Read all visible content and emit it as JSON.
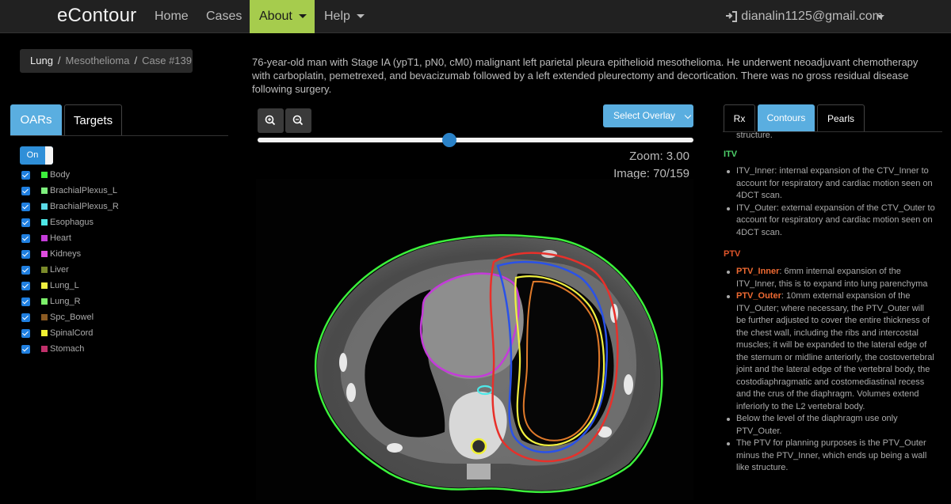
{
  "navbar": {
    "brand": "eContour",
    "home": "Home",
    "cases": "Cases",
    "about": "About",
    "help": "Help",
    "user": "dianalin1125@gmail.com",
    "accent": "#a6cc4d"
  },
  "breadcrumb": {
    "items": [
      "Lung",
      "Mesothelioma",
      "Case #139"
    ]
  },
  "case_description": "76-year-old man with Stage IA (ypT1, pN0, cM0) malignant left parietal pleura epithelioid mesothelioma. He underwent neoadjuvant chemotherapy with carboplatin, pemetrexed, and bevacizumab followed by a left extended pleurectomy and decortication. There was no gross residual disease following surgery.",
  "left_panel": {
    "tabs": [
      "OARs",
      "Targets"
    ],
    "toggle_label": "On",
    "structures": [
      {
        "name": "Body",
        "color": "#3cf03c",
        "checked": true
      },
      {
        "name": "BrachialPlexus_L",
        "color": "#7ef07e",
        "checked": true
      },
      {
        "name": "BrachialPlexus_R",
        "color": "#5ad9e6",
        "checked": true
      },
      {
        "name": "Esophagus",
        "color": "#4ee8e8",
        "checked": true
      },
      {
        "name": "Heart",
        "color": "#c43cd9",
        "checked": true
      },
      {
        "name": "Kidneys",
        "color": "#e04ce0",
        "checked": true
      },
      {
        "name": "Liver",
        "color": "#7a8a2a",
        "checked": true
      },
      {
        "name": "Lung_L",
        "color": "#f0f040",
        "checked": true
      },
      {
        "name": "Lung_R",
        "color": "#7cf06a",
        "checked": true
      },
      {
        "name": "Spc_Bowel",
        "color": "#8a5a22",
        "checked": true
      },
      {
        "name": "SpinalCord",
        "color": "#f0f032",
        "checked": true
      },
      {
        "name": "Stomach",
        "color": "#c0306a",
        "checked": true
      }
    ]
  },
  "viewer": {
    "select_overlay": "Select Overlay",
    "zoom_text": "Zoom: 3.00",
    "image_text": "Image: 70/159",
    "slider_fraction": 0.44,
    "zoom_in_icon": "zoom-in-icon",
    "zoom_out_icon": "zoom-out-icon"
  },
  "right_panel": {
    "tabs": [
      "Rx",
      "Contours",
      "Pearls"
    ],
    "top_fragment": "structure.",
    "itv_heading": "ITV",
    "itv_items": [
      "ITV_Inner: internal expansion of the CTV_Inner to account for respiratory and cardiac motion seen on 4DCT scan.",
      "ITV_Outer: external expansion of the CTV_Outer to account for respiratory and cardiac motion seen on 4DCT scan."
    ],
    "ptv_heading": "PTV",
    "ptv_items": [
      {
        "label": "PTV_Inner",
        "text": ": 6mm internal expansion of the ITV_Inner, this is to expand into lung parenchyma"
      },
      {
        "label": "PTV_Outer",
        "text": ": 10mm external expansion of the ITV_Outer; where necessary, the PTV_Outer will be further adjusted to cover the entire thickness of the chest wall, including the ribs and intercostal muscles; it will be expanded to the lateral edge of the sternum or midline anteriorly, the costovertebral joint and the lateral edge of the vertebral body, the costodiaphragmatic and costomediastinal recess and the crus of the diaphragm. Volumes extend inferiorly to the L2 vertebral body."
      },
      {
        "label": "",
        "text": "Below the level of the diaphragm use only PTV_Outer."
      },
      {
        "label": "",
        "text": "The PTV for planning purposes is the PTV_Outer minus the PTV_Inner, which ends up being a wall like structure."
      }
    ]
  }
}
